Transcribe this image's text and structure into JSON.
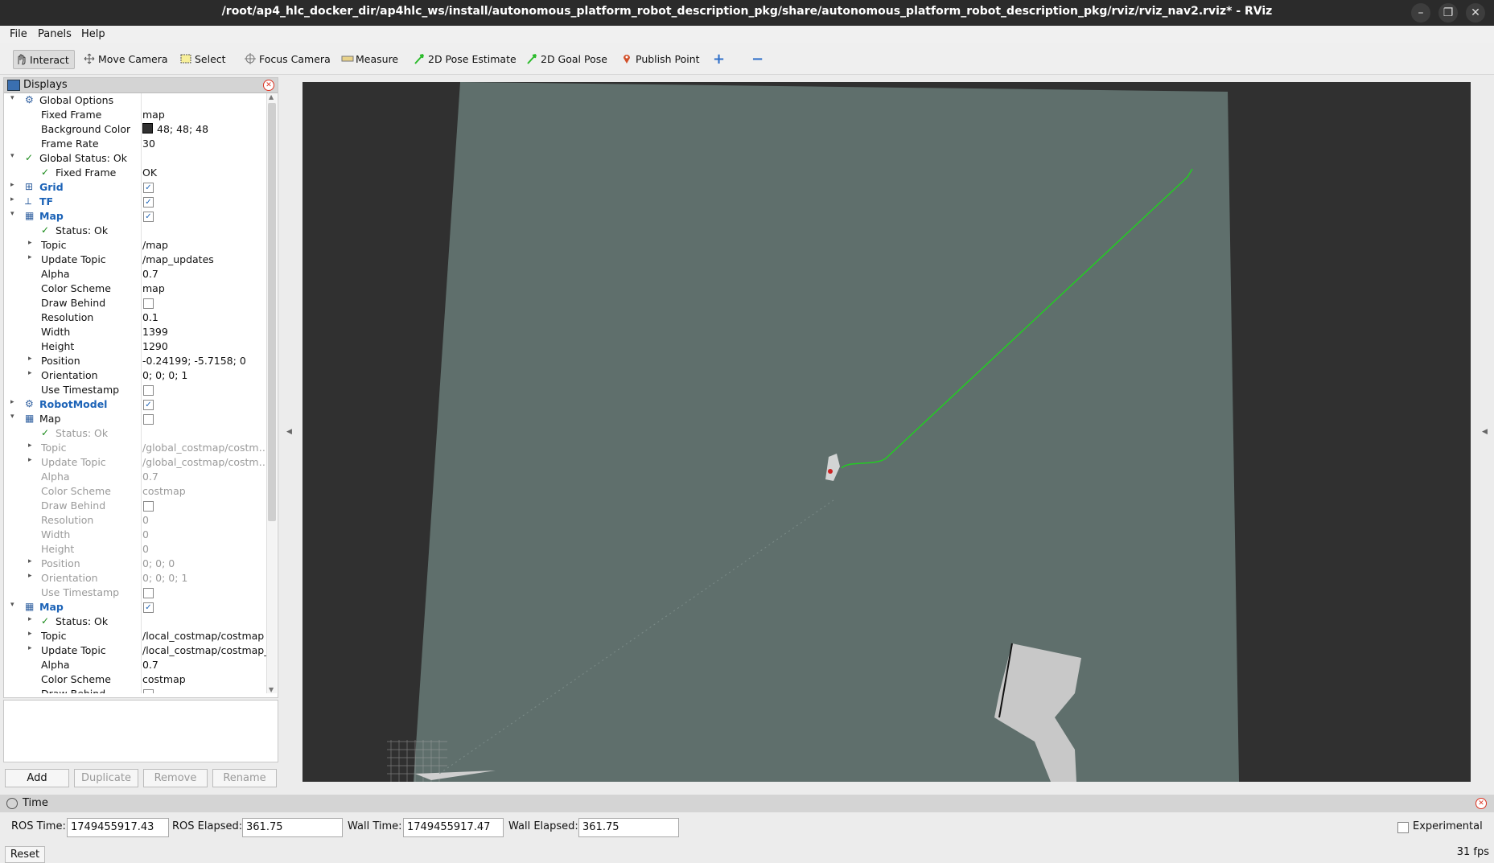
{
  "window": {
    "title": "/root/ap4_hlc_docker_dir/ap4hlc_ws/install/autonomous_platform_robot_description_pkg/share/autonomous_platform_robot_description_pkg/rviz/rviz_nav2.rviz* - RViz",
    "controls": [
      "–",
      "❐",
      "✕"
    ]
  },
  "menubar": {
    "file": "File",
    "panels": "Panels",
    "help": "Help"
  },
  "toolbar": {
    "interact": "Interact",
    "move_camera": "Move Camera",
    "select": "Select",
    "focus_camera": "Focus Camera",
    "measure": "Measure",
    "pose_estimate": "2D Pose Estimate",
    "goal_pose": "2D Goal Pose",
    "publish_point": "Publish Point",
    "add_tool": "+",
    "remove_tool": "−"
  },
  "displays": {
    "title": "Displays",
    "rows": [
      {
        "arrow": "▾",
        "indent": 0,
        "icon": "gear",
        "name": "Global Options",
        "value": "",
        "style": "normal"
      },
      {
        "arrow": "",
        "indent": 1,
        "name": "Fixed Frame",
        "value": "map",
        "style": "normal"
      },
      {
        "arrow": "",
        "indent": 1,
        "name": "Background Color",
        "value": "48; 48; 48",
        "swatch": "#303030",
        "style": "normal"
      },
      {
        "arrow": "",
        "indent": 1,
        "name": "Frame Rate",
        "value": "30",
        "style": "normal"
      },
      {
        "arrow": "▾",
        "indent": 0,
        "icon": "check",
        "name": "Global Status: Ok",
        "value": "",
        "style": "normal"
      },
      {
        "arrow": "",
        "indent": 1,
        "icon": "check",
        "name": "Fixed Frame",
        "value": "OK",
        "style": "normal"
      },
      {
        "arrow": "▸",
        "indent": 0,
        "icon": "grid",
        "name": "Grid",
        "value": "",
        "check": true,
        "style": "blue"
      },
      {
        "arrow": "▸",
        "indent": 0,
        "icon": "tf",
        "name": "TF",
        "value": "",
        "check": true,
        "style": "blue"
      },
      {
        "arrow": "▾",
        "indent": 0,
        "icon": "map",
        "name": "Map",
        "value": "",
        "check": true,
        "style": "blue"
      },
      {
        "arrow": "",
        "indent": 1,
        "icon": "check",
        "name": "Status: Ok",
        "value": "",
        "style": "normal"
      },
      {
        "arrow": "▸",
        "indent": 1,
        "name": "Topic",
        "value": "/map",
        "style": "normal"
      },
      {
        "arrow": "▸",
        "indent": 1,
        "name": "Update Topic",
        "value": "/map_updates",
        "style": "normal"
      },
      {
        "arrow": "",
        "indent": 1,
        "name": "Alpha",
        "value": "0.7",
        "style": "normal"
      },
      {
        "arrow": "",
        "indent": 1,
        "name": "Color Scheme",
        "value": "map",
        "style": "normal"
      },
      {
        "arrow": "",
        "indent": 1,
        "name": "Draw Behind",
        "value": "",
        "check": false,
        "style": "normal"
      },
      {
        "arrow": "",
        "indent": 1,
        "name": "Resolution",
        "value": "0.1",
        "style": "normal"
      },
      {
        "arrow": "",
        "indent": 1,
        "name": "Width",
        "value": "1399",
        "style": "normal"
      },
      {
        "arrow": "",
        "indent": 1,
        "name": "Height",
        "value": "1290",
        "style": "normal"
      },
      {
        "arrow": "▸",
        "indent": 1,
        "name": "Position",
        "value": "-0.24199; -5.7158; 0",
        "style": "normal"
      },
      {
        "arrow": "▸",
        "indent": 1,
        "name": "Orientation",
        "value": "0; 0; 0; 1",
        "style": "normal"
      },
      {
        "arrow": "",
        "indent": 1,
        "name": "Use Timestamp",
        "value": "",
        "check": false,
        "style": "normal"
      },
      {
        "arrow": "▸",
        "indent": 0,
        "icon": "robot",
        "name": "RobotModel",
        "value": "",
        "check": true,
        "style": "blue"
      },
      {
        "arrow": "▾",
        "indent": 0,
        "icon": "map",
        "name": "Map",
        "value": "",
        "check": false,
        "style": "normal"
      },
      {
        "arrow": "",
        "indent": 1,
        "icon": "check",
        "name": "Status: Ok",
        "value": "",
        "style": "dim"
      },
      {
        "arrow": "▸",
        "indent": 1,
        "name": "Topic",
        "value": "/global_costmap/costmap",
        "style": "dim"
      },
      {
        "arrow": "▸",
        "indent": 1,
        "name": "Update Topic",
        "value": "/global_costmap/costma...",
        "style": "dim"
      },
      {
        "arrow": "",
        "indent": 1,
        "name": "Alpha",
        "value": "0.7",
        "style": "dim"
      },
      {
        "arrow": "",
        "indent": 1,
        "name": "Color Scheme",
        "value": "costmap",
        "style": "dim"
      },
      {
        "arrow": "",
        "indent": 1,
        "name": "Draw Behind",
        "value": "",
        "check": false,
        "style": "dim"
      },
      {
        "arrow": "",
        "indent": 1,
        "name": "Resolution",
        "value": "0",
        "style": "dim"
      },
      {
        "arrow": "",
        "indent": 1,
        "name": "Width",
        "value": "0",
        "style": "dim"
      },
      {
        "arrow": "",
        "indent": 1,
        "name": "Height",
        "value": "0",
        "style": "dim"
      },
      {
        "arrow": "▸",
        "indent": 1,
        "name": "Position",
        "value": "0; 0; 0",
        "style": "dim"
      },
      {
        "arrow": "▸",
        "indent": 1,
        "name": "Orientation",
        "value": "0; 0; 0; 1",
        "style": "dim"
      },
      {
        "arrow": "",
        "indent": 1,
        "name": "Use Timestamp",
        "value": "",
        "check": false,
        "style": "dim"
      },
      {
        "arrow": "▾",
        "indent": 0,
        "icon": "map",
        "name": "Map",
        "value": "",
        "check": true,
        "style": "blue"
      },
      {
        "arrow": "▸",
        "indent": 1,
        "icon": "check",
        "name": "Status: Ok",
        "value": "",
        "style": "normal"
      },
      {
        "arrow": "▸",
        "indent": 1,
        "name": "Topic",
        "value": "/local_costmap/costmap",
        "style": "normal"
      },
      {
        "arrow": "▸",
        "indent": 1,
        "name": "Update Topic",
        "value": "/local_costmap/costmap_",
        "style": "normal"
      },
      {
        "arrow": "",
        "indent": 1,
        "name": "Alpha",
        "value": "0.7",
        "style": "normal"
      },
      {
        "arrow": "",
        "indent": 1,
        "name": "Color Scheme",
        "value": "costmap",
        "style": "normal"
      },
      {
        "arrow": "",
        "indent": 1,
        "name": "Draw Behind",
        "value": "",
        "check": false,
        "style": "normal"
      }
    ]
  },
  "buttons": {
    "add": "Add",
    "duplicate": "Duplicate",
    "remove": "Remove",
    "rename": "Rename"
  },
  "time": {
    "title": "Time",
    "ros_time_label": "ROS Time:",
    "ros_time": "1749455917.43",
    "ros_elapsed_label": "ROS Elapsed:",
    "ros_elapsed": "361.75",
    "wall_time_label": "Wall Time:",
    "wall_time": "1749455917.47",
    "wall_elapsed_label": "Wall Elapsed:",
    "wall_elapsed": "361.75",
    "experimental_label": "Experimental",
    "reset": "Reset",
    "fps": "31 fps"
  },
  "colors": {
    "background": "#303030",
    "map": "#5f6f6c",
    "path": "#22cc22",
    "accent": "#1c63b7"
  }
}
